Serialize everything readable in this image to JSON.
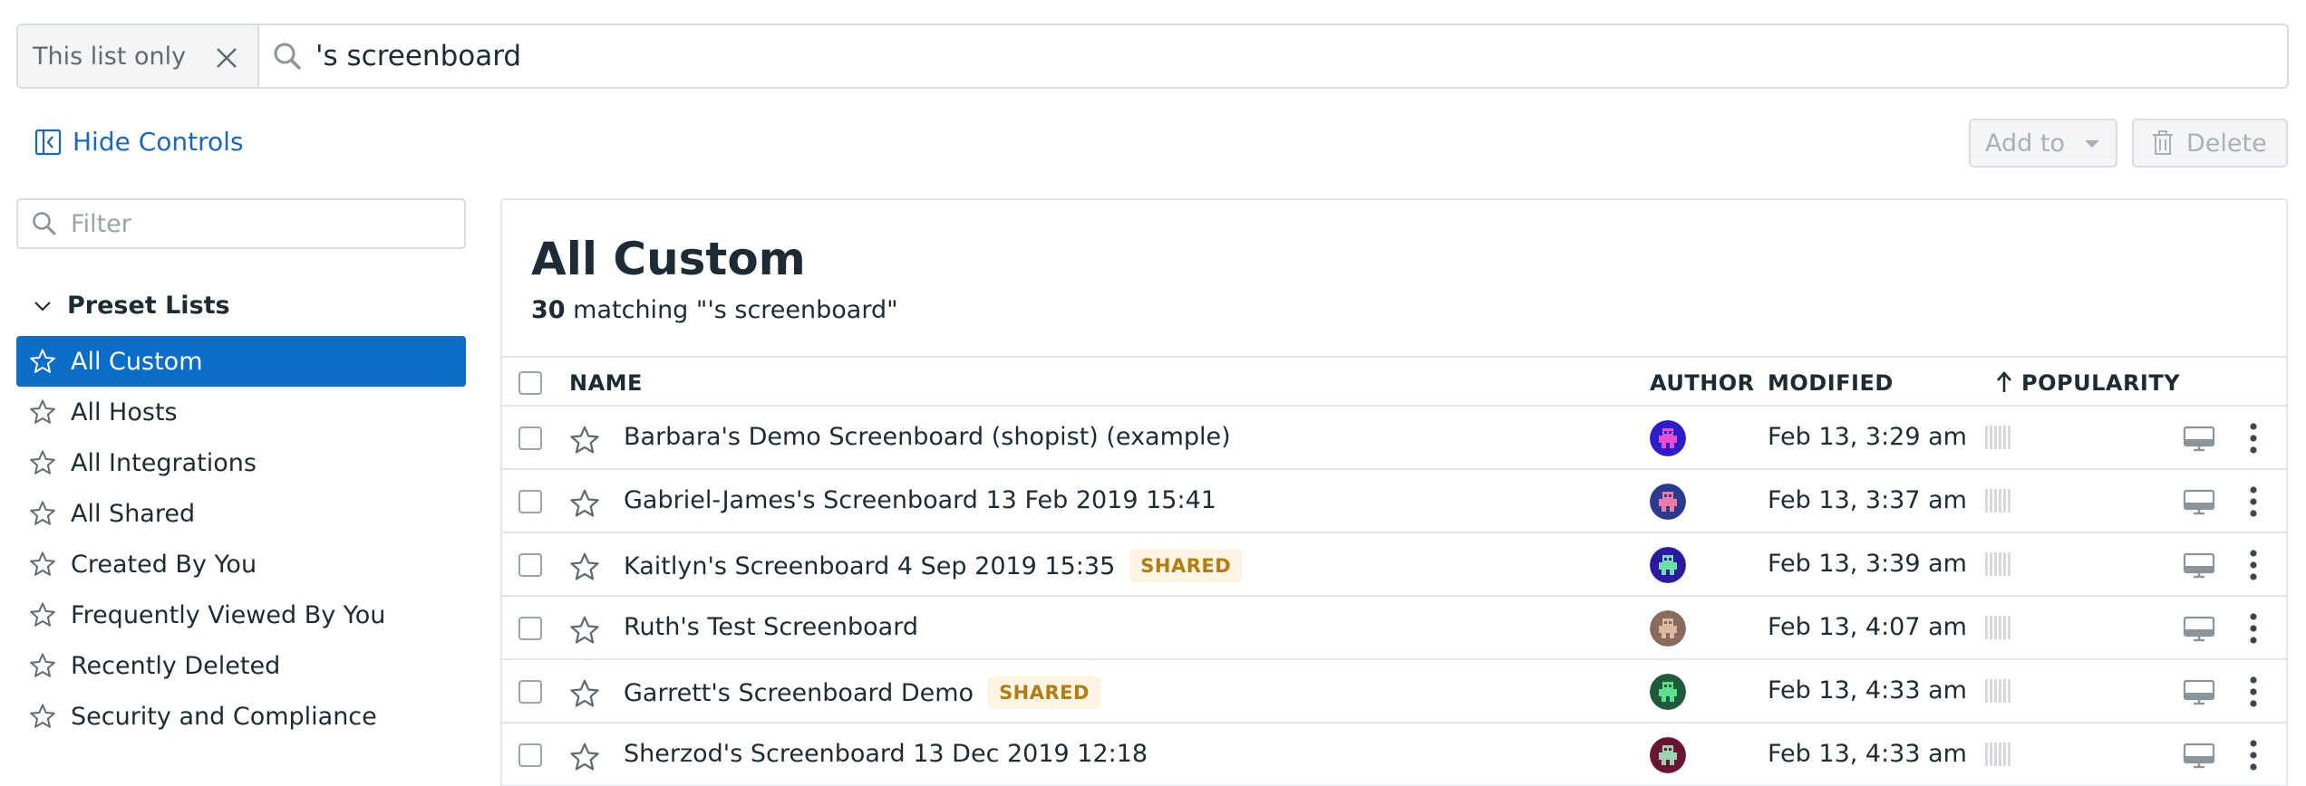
{
  "search": {
    "scope_label": "This list only",
    "query": "'s screenboard"
  },
  "controls": {
    "hide_label": "Hide Controls",
    "add_to_label": "Add to",
    "delete_label": "Delete"
  },
  "sidebar": {
    "filter_placeholder": "Filter",
    "section_title": "Preset Lists",
    "items": [
      {
        "label": "All Custom",
        "active": true
      },
      {
        "label": "All Hosts"
      },
      {
        "label": "All Integrations"
      },
      {
        "label": "All Shared"
      },
      {
        "label": "Created By You"
      },
      {
        "label": "Frequently Viewed By You"
      },
      {
        "label": "Recently Deleted"
      },
      {
        "label": "Security and Compliance"
      }
    ]
  },
  "main": {
    "title": "All Custom",
    "count": "30",
    "matching_text": "matching \"'s screenboard\"",
    "columns": {
      "name": "NAME",
      "author": "AUTHOR",
      "modified": "MODIFIED",
      "popularity": "POPULARITY"
    },
    "rows": [
      {
        "name": "Barbara's Demo Screenboard (shopist) (example)",
        "badge": "",
        "modified": "Feb 13, 3:29 am",
        "avatar_color": "#2c1dc9",
        "avatar_fg": "#e84fd1"
      },
      {
        "name": "Gabriel-James's Screenboard 13 Feb 2019 15:41",
        "badge": "",
        "modified": "Feb 13, 3:37 am",
        "avatar_color": "#2a3a8c",
        "avatar_fg": "#f07aa8"
      },
      {
        "name": "Kaitlyn's Screenboard 4 Sep 2019 15:35",
        "badge": "SHARED",
        "modified": "Feb 13, 3:39 am",
        "avatar_color": "#2b1a9e",
        "avatar_fg": "#6fe0a7"
      },
      {
        "name": "Ruth's Test Screenboard",
        "badge": "",
        "modified": "Feb 13, 4:07 am",
        "avatar_color": "#8a6a5c",
        "avatar_fg": "#d9b9a0"
      },
      {
        "name": "Garrett's Screenboard Demo",
        "badge": "SHARED",
        "modified": "Feb 13, 4:33 am",
        "avatar_color": "#1f5a3c",
        "avatar_fg": "#5ce08a"
      },
      {
        "name": "Sherzod's Screenboard 13 Dec 2019 12:18",
        "badge": "",
        "modified": "Feb 13, 4:33 am",
        "avatar_color": "#6b1536",
        "avatar_fg": "#9fd0b0"
      }
    ]
  },
  "colors": {
    "accent": "#0b6dc5",
    "link": "#1f66b5",
    "badge_text": "#b07d12",
    "badge_bg": "#fdf4e3"
  },
  "icons": {
    "scope_clear": "close-icon",
    "search": "search-icon",
    "hide_controls": "collapse-panel-icon",
    "add_to_caret": "caret-down-icon",
    "delete": "trash-icon",
    "section_toggle": "chevron-down-icon",
    "list_item": "star-icon",
    "sort": "arrow-up-icon",
    "tv_mode": "monitor-icon",
    "row_menu": "more-vertical-icon"
  }
}
